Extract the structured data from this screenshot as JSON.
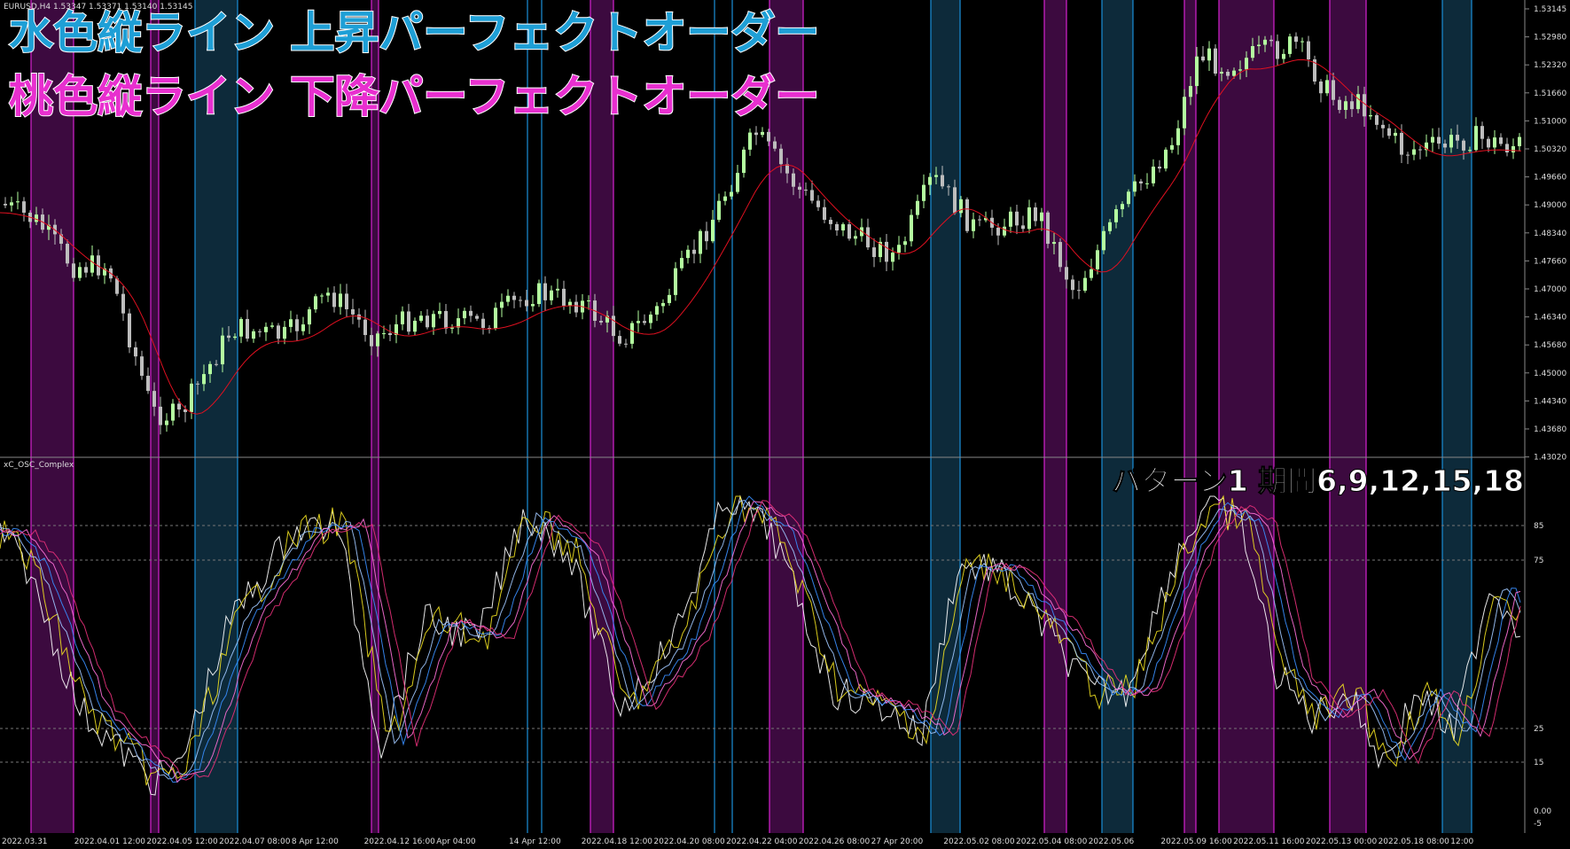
{
  "headline": {
    "line1": "水色縦ライン 上昇パーフェクトオーダー",
    "line2": "桃色縦ライン 下降パーフェクトオーダー",
    "line1_color": "#1e9fd6",
    "line2_color": "#e82fcf"
  },
  "main_window": {
    "symbol_info": "EURUSD,H4  1.53347 1.53371 1.53140 1.53145",
    "price_ticks": [
      "1.53145",
      "1.52980",
      "1.52320",
      "1.51660",
      "1.51000",
      "1.50320",
      "1.49660",
      "1.49000",
      "1.48340",
      "1.47660",
      "1.47000",
      "1.46340",
      "1.45680",
      "1.45000",
      "1.44340",
      "1.43680",
      "1.43020"
    ],
    "current_price": "1.53145"
  },
  "sub_window": {
    "indicator_name": "xC_OSC_Complex",
    "pattern_label": "パターン1 期間6,9,12,15,18",
    "levels": [
      "85",
      "75",
      "25",
      "15"
    ],
    "bottom_labels": [
      "0.00",
      "-5"
    ]
  },
  "time_axis": {
    "labels": [
      "2022.03.31",
      "2022.04.01 12:00",
      "2022.04.05 12:00",
      "2022.04.07 08:00",
      "8 Apr 12:00",
      "2022.04.12 16:00",
      "Apr 04:00",
      "14 Apr 12:00",
      "2022.04.18 12:00",
      "2022.04.20 08:00",
      "2022.04.22 04:00",
      "2022.04.26 08:00",
      "27 Apr 20:00",
      "2022.05.02 08:00",
      "2022.05.04 08:00",
      "2022.05.06",
      "2022.05.09 16:00",
      "2022.05.11 16:00",
      "2022.05.13 00:00",
      "2022.05.18 08:00",
      "12:00"
    ]
  },
  "colors": {
    "cyan_band": "#0d2a3a",
    "cyan_line": "#1a8fd8",
    "pink_band": "#3c0a3f",
    "pink_line": "#d622d0",
    "bull_candle": "#b4ffa0",
    "bear_candle": "#bdbdbd",
    "ma_line": "#e01020"
  }
}
